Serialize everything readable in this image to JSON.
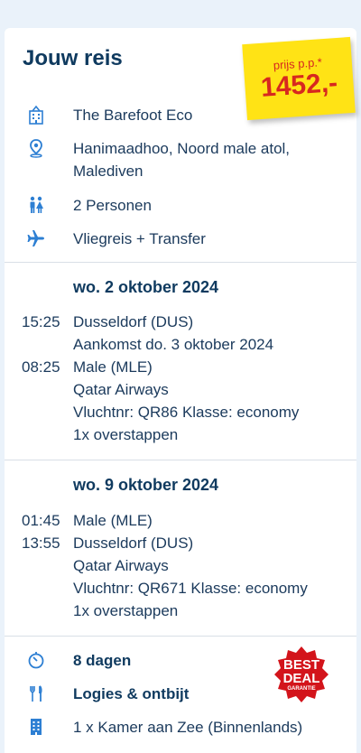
{
  "header": {
    "title": "Jouw reis"
  },
  "price_sticker": {
    "per_person_label": "prijs p.p.*",
    "amount": "1452,-"
  },
  "trip": {
    "hotel": "The Barefoot Eco",
    "location_line1": "Hanimaadhoo, Noord male atol,",
    "location_line2": "Malediven",
    "persons": "2 Personen",
    "travel_type": "Vliegreis + Transfer"
  },
  "outbound": {
    "date": "wo. 2 oktober 2024",
    "dep_time": "15:25",
    "dep_airport": "Dusseldorf (DUS)",
    "arrival_note": "Aankomst do. 3 oktober 2024",
    "arr_time": "08:25",
    "arr_airport": "Male (MLE)",
    "airline": "Qatar Airways",
    "flight_info": "Vluchtnr: QR86 Klasse: economy",
    "stops": "1x overstappen"
  },
  "return": {
    "date": "wo. 9 oktober 2024",
    "dep_time": "01:45",
    "dep_airport": "Male (MLE)",
    "arr_time": "13:55",
    "arr_airport": "Dusseldorf (DUS)",
    "airline": "Qatar Airways",
    "flight_info": "Vluchtnr: QR671 Klasse: economy",
    "stops": "1x overstappen"
  },
  "stay": {
    "duration": "8 dagen",
    "board": "Logies & ontbijt",
    "room": "1 x Kamer aan Zee (Binnenlands)"
  },
  "badge": {
    "line1": "BEST",
    "line2": "DEAL",
    "line3": "GARANTIE"
  },
  "colors": {
    "accent_blue": "#2d7fd3",
    "dark_blue": "#0f3a5f",
    "sticker_yellow": "#ffe315",
    "price_red": "#d7281f",
    "badge_red": "#d3141b"
  }
}
